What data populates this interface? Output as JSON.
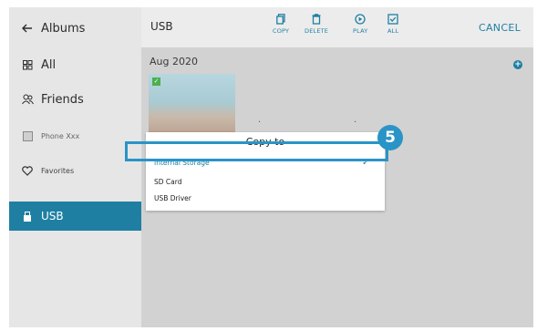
{
  "sidebar": {
    "back_label": "Albums",
    "items": [
      {
        "label": "All",
        "icon": "grid-icon"
      },
      {
        "label": "Friends",
        "icon": "people-icon"
      },
      {
        "label": "Phone Xxx",
        "icon": "phone-square-icon"
      },
      {
        "label": "Favorites",
        "icon": "heart-icon"
      },
      {
        "label": "USB",
        "icon": "usb-icon"
      }
    ]
  },
  "header": {
    "title": "USB",
    "tools": [
      {
        "label": "COPY",
        "icon": "copy-icon"
      },
      {
        "label": "DELETE",
        "icon": "trash-icon"
      },
      {
        "label": "PLAY",
        "icon": "play-icon"
      },
      {
        "label": "ALL",
        "icon": "select-all-icon"
      }
    ],
    "cancel_label": "CANCEL"
  },
  "content": {
    "date_label": "Aug 2020"
  },
  "dialog": {
    "title": "Copy to",
    "options": [
      "Internal Storage",
      "SD Card",
      "USB Driver"
    ]
  },
  "callout": {
    "number": "5"
  },
  "colors": {
    "accent": "#1f7fa2",
    "highlight": "#2a94c6",
    "sidebar_bg": "#e6e6e6",
    "content_bg": "#d2d2d2"
  }
}
